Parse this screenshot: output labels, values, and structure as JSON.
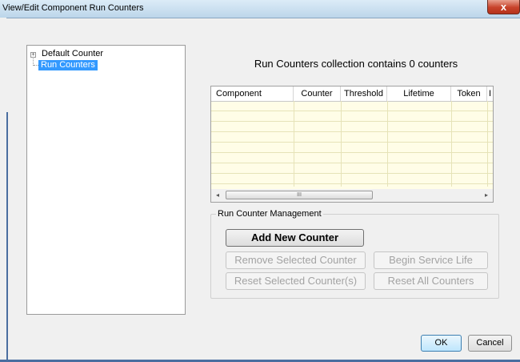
{
  "window": {
    "title": "View/Edit Component Run Counters",
    "close_glyph": "x"
  },
  "tree": {
    "expander_glyph": "+",
    "items": [
      {
        "label": "Default Counter"
      },
      {
        "label": "Run Counters"
      }
    ]
  },
  "collection": {
    "header": "Run Counters collection contains 0 counters"
  },
  "grid": {
    "columns": [
      "Component",
      "Counter",
      "Threshold",
      "Lifetime",
      "Token",
      "I"
    ],
    "rows": [],
    "scroll_left_glyph": "◂",
    "scroll_right_glyph": "▸",
    "scroll_thumb_glyph": "III",
    "row_color": "#fffde7"
  },
  "management": {
    "title": "Run Counter Management",
    "add_label": "Add New Counter",
    "remove_label": "Remove Selected Counter",
    "begin_label": "Begin Service Life",
    "reset_selected_label": "Reset Selected Counter(s)",
    "reset_all_label": "Reset All Counters"
  },
  "footer": {
    "ok_label": "OK",
    "cancel_label": "Cancel"
  },
  "colors": {
    "selection": "#3399ff",
    "close": "#c7422a"
  }
}
